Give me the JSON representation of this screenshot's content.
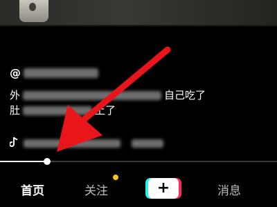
{
  "author": {
    "at_sign": "@"
  },
  "caption": {
    "line1_start": "外",
    "line1_end": "自己吃了",
    "line2_start": "肚",
    "line2_end": "上了"
  },
  "music": {
    "icon": "tiktok-note-icon"
  },
  "progress": {
    "value": 0.17
  },
  "tabbar": {
    "home": "首页",
    "follow": "关注",
    "plus": "+",
    "messages": "消息"
  },
  "colors": {
    "arrow": "#e8151b",
    "follow_dot": "#f5c518",
    "plus_cyan": "#25f4ee",
    "plus_red": "#fe2c55"
  }
}
